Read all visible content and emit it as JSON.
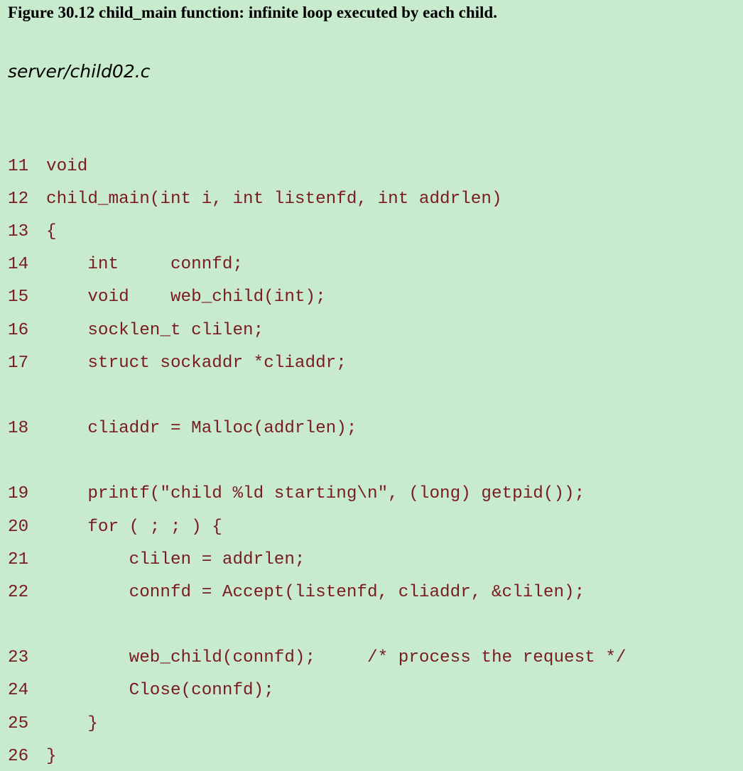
{
  "figure": {
    "caption": "Figure 30.12 child_main function: infinite loop executed by each child.",
    "filename": "server/child02.c"
  },
  "colors": {
    "background": "#c8ebce",
    "code_text": "#7a1a26",
    "caption_text": "#000000"
  },
  "code_lines": [
    {
      "num": "11",
      "text": "void"
    },
    {
      "num": "12",
      "text": "child_main(int i, int listenfd, int addrlen)"
    },
    {
      "num": "13",
      "text": "{"
    },
    {
      "num": "14",
      "text": "    int     connfd;"
    },
    {
      "num": "15",
      "text": "    void    web_child(int);"
    },
    {
      "num": "16",
      "text": "    socklen_t clilen;"
    },
    {
      "num": "17",
      "text": "    struct sockaddr *cliaddr;"
    },
    {
      "num": "18",
      "text": "    cliaddr = Malloc(addrlen);"
    },
    {
      "num": "19",
      "text": "    printf(\"child %ld starting\\n\", (long) getpid());"
    },
    {
      "num": "20",
      "text": "    for ( ; ; ) {"
    },
    {
      "num": "21",
      "text": "        clilen = addrlen;"
    },
    {
      "num": "22",
      "text": "        connfd = Accept(listenfd, cliaddr, &clilen);"
    },
    {
      "num": "23",
      "text": "        web_child(connfd);     /* process the request */"
    },
    {
      "num": "24",
      "text": "        Close(connfd);"
    },
    {
      "num": "25",
      "text": "    }"
    },
    {
      "num": "26",
      "text": "}"
    }
  ]
}
